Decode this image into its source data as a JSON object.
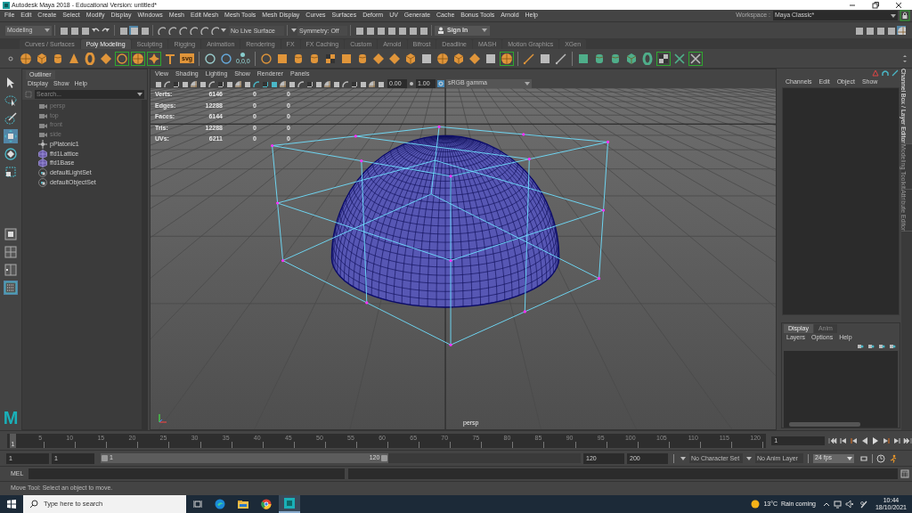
{
  "window": {
    "title": "Autodesk Maya 2018 - Educational Version: untitled*"
  },
  "menu_bar": {
    "items": [
      "File",
      "Edit",
      "Create",
      "Select",
      "Modify",
      "Display",
      "Windows",
      "Mesh",
      "Edit Mesh",
      "Mesh Tools",
      "Mesh Display",
      "Curves",
      "Surfaces",
      "Deform",
      "UV",
      "Generate",
      "Cache",
      "Bonus Tools",
      "Arnold",
      "Help"
    ],
    "workspace_label": "Workspace :",
    "workspace": "Maya Classic*"
  },
  "status_line": {
    "menu_set": "Modeling",
    "live_surface": "No Live Surface",
    "symmetry": "Symmetry: Off",
    "sign_in": "Sign In"
  },
  "shelf_tabs": [
    {
      "label": "Curves / Surfaces",
      "selected": false
    },
    {
      "label": "Poly Modeling",
      "selected": true
    },
    {
      "label": "Sculpting",
      "selected": false
    },
    {
      "label": "Rigging",
      "selected": false
    },
    {
      "label": "Animation",
      "selected": false
    },
    {
      "label": "Rendering",
      "selected": false
    },
    {
      "label": "FX",
      "selected": false
    },
    {
      "label": "FX Caching",
      "selected": false
    },
    {
      "label": "Custom",
      "selected": false
    },
    {
      "label": "Arnold",
      "selected": false
    },
    {
      "label": "Bifrost",
      "selected": false
    },
    {
      "label": "Deadline",
      "selected": false
    },
    {
      "label": "MASH",
      "selected": false
    },
    {
      "label": "Motion Graphics",
      "selected": false
    },
    {
      "label": "XGen",
      "selected": false
    }
  ],
  "shelf": {
    "svg_icon_label": "svg",
    "pivot_icon_label": "0,0,0"
  },
  "toolbox": {
    "logo": "M"
  },
  "outliner": {
    "title": "Outliner",
    "menu": [
      "Display",
      "Show",
      "Help"
    ],
    "search_placeholder": "Search...",
    "items": [
      {
        "label": "persp",
        "kind": "camera",
        "dimmed": true
      },
      {
        "label": "top",
        "kind": "camera",
        "dimmed": true
      },
      {
        "label": "front",
        "kind": "camera",
        "dimmed": true
      },
      {
        "label": "side",
        "kind": "camera",
        "dimmed": true
      },
      {
        "label": "pPlatonic1",
        "kind": "transform",
        "dimmed": false
      },
      {
        "label": "ffd1Lattice",
        "kind": "lattice",
        "dimmed": false
      },
      {
        "label": "ffd1Base",
        "kind": "lattice",
        "dimmed": false
      },
      {
        "label": "defaultLightSet",
        "kind": "set",
        "dimmed": false
      },
      {
        "label": "defaultObjectSet",
        "kind": "set",
        "dimmed": false
      }
    ]
  },
  "viewport": {
    "menu": [
      "View",
      "Shading",
      "Lighting",
      "Show",
      "Renderer",
      "Panels"
    ],
    "exposure": "0.00",
    "gamma": "1.00",
    "color_space": "sRGB gamma",
    "camera_label": "persp",
    "stats": [
      {
        "label": "Verts:",
        "values": [
          "6146",
          "0",
          "0"
        ]
      },
      {
        "label": "Edges:",
        "values": [
          "12288",
          "0",
          "0"
        ]
      },
      {
        "label": "Faces:",
        "values": [
          "6144",
          "0",
          "0"
        ]
      },
      {
        "label": "Tris:",
        "values": [
          "12288",
          "0",
          "0"
        ]
      },
      {
        "label": "UVs:",
        "values": [
          "6211",
          "0",
          "0"
        ]
      }
    ]
  },
  "channel_box": {
    "menu": [
      "Channels",
      "Edit",
      "Object",
      "Show"
    ]
  },
  "side_tabs": [
    {
      "label": "Channel Box / Layer Editor",
      "selected": true
    },
    {
      "label": "Modeling Toolkit",
      "selected": false
    },
    {
      "label": "Attribute Editor",
      "selected": false
    }
  ],
  "layer_editor": {
    "tabs": [
      {
        "label": "Display",
        "selected": true
      },
      {
        "label": "Anim",
        "selected": false
      }
    ],
    "menu": [
      "Layers",
      "Options",
      "Help"
    ]
  },
  "timeline": {
    "current_frame_marker": "1",
    "level": 0,
    "ticks": [
      "5",
      "10",
      "15",
      "20",
      "25",
      "30",
      "35",
      "40",
      "45",
      "50",
      "55",
      "60",
      "65",
      "70",
      "75",
      "80",
      "85",
      "90",
      "95",
      "100",
      "105",
      "110",
      "115",
      "120"
    ],
    "current_frame": "1"
  },
  "range": {
    "start": "1",
    "playback_start": "1",
    "slider_start": "1",
    "slider_end": "120",
    "level": 0.6,
    "playback_end": "120",
    "end": "200",
    "character_set": "No Character Set",
    "anim_layer": "No Anim Layer",
    "fps": "24 fps"
  },
  "command_line": {
    "label": "MEL"
  },
  "help_line": "Move Tool: Select an object to move.",
  "taskbar": {
    "search_placeholder": "Type here to search",
    "temperature": "13°C",
    "weather": "Rain coming",
    "time": "10:44",
    "date": "18/10/2021"
  }
}
